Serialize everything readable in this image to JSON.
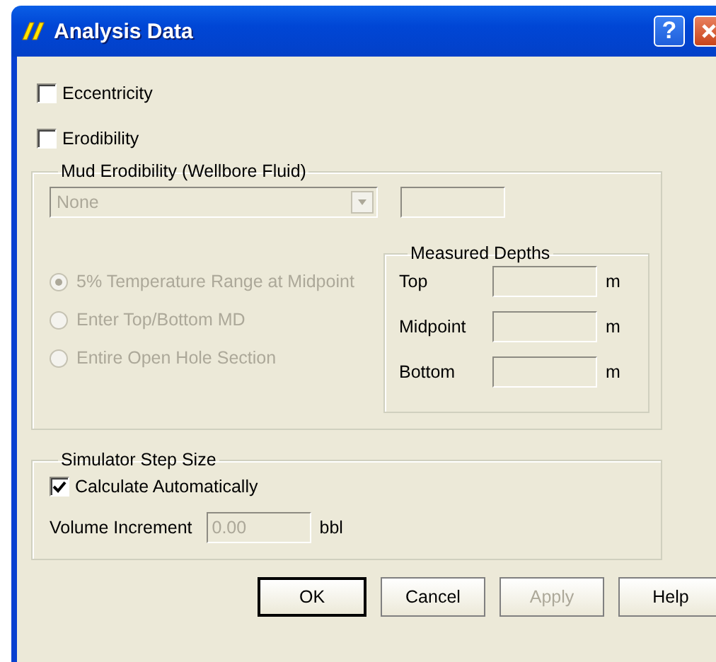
{
  "window": {
    "title": "Analysis Data",
    "help_button": "?"
  },
  "options": [
    {
      "label": "Eccentricity",
      "checked": false
    },
    {
      "label": "Erodibility",
      "checked": false
    }
  ],
  "mud_erodibility": {
    "title": "Mud Erodibility (Wellbore Fluid)",
    "disabled": true,
    "dropdown": {
      "value": "None"
    },
    "radios": [
      {
        "label": "5% Temperature Range at Midpoint",
        "selected": true
      },
      {
        "label": "Enter Top/Bottom MD",
        "selected": false
      },
      {
        "label": "Entire Open Hole Section",
        "selected": false
      }
    ],
    "measured_depths": {
      "title": "Measured Depths",
      "rows": [
        {
          "label": "Top",
          "unit": "m"
        },
        {
          "label": "Midpoint",
          "unit": "m"
        },
        {
          "label": "Bottom",
          "unit": "m"
        }
      ]
    }
  },
  "simulator_step_size": {
    "title": "Simulator Step Size",
    "calculate_automatically": {
      "label": "Calculate Automatically",
      "checked": true
    },
    "volume_increment": {
      "label": "Volume Increment",
      "value": "0.00",
      "unit": "bbl",
      "disabled": true
    }
  },
  "buttons": [
    {
      "label": "OK",
      "default": true,
      "disabled": false
    },
    {
      "label": "Cancel",
      "default": false,
      "disabled": false
    },
    {
      "label": "Apply",
      "default": false,
      "disabled": true
    },
    {
      "label": "Help",
      "default": false,
      "disabled": false
    }
  ]
}
